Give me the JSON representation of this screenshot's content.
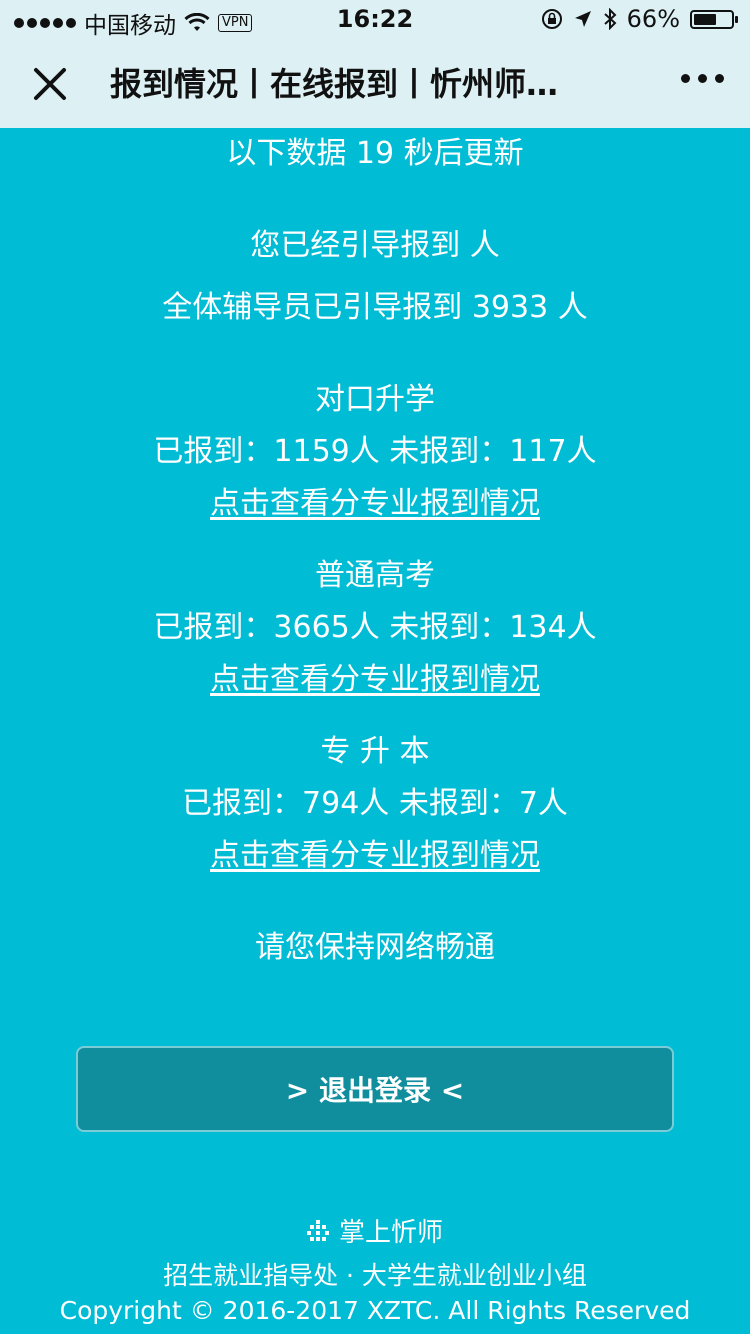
{
  "status_bar": {
    "carrier": "中国移动",
    "vpn": "VPN",
    "time": "16:22",
    "battery": "66%",
    "battery_level": 0.66
  },
  "nav": {
    "title": "报到情况丨在线报到丨忻州师…"
  },
  "main": {
    "countdown": "以下数据 19 秒后更新",
    "you_guided": "您已经引导报到  人",
    "all_guided": "全体辅导员已引导报到 3933 人",
    "sections": [
      {
        "title": "对口升学",
        "stats": "已报到：1159人  未报到：117人",
        "link": "点击查看分专业报到情况"
      },
      {
        "title": "普通高考",
        "stats": "已报到：3665人  未报到：134人",
        "link": "点击查看分专业报到情况"
      },
      {
        "title": "专 升 本",
        "stats": "已报到：794人  未报到：7人",
        "link": "点击查看分专业报到情况"
      }
    ],
    "network_tip": "请您保持网络畅通"
  },
  "logout_button": "> 退出登录 <",
  "footer": {
    "brand": "掌上忻师",
    "org": "招生就业指导处 · 大学生就业创业小组",
    "copyright": "Copyright © 2016-2017 XZTC. All Rights Reserved"
  },
  "colors": {
    "background": "#00BCD4",
    "header": "#DDF1F4",
    "button": "#118E9E"
  }
}
